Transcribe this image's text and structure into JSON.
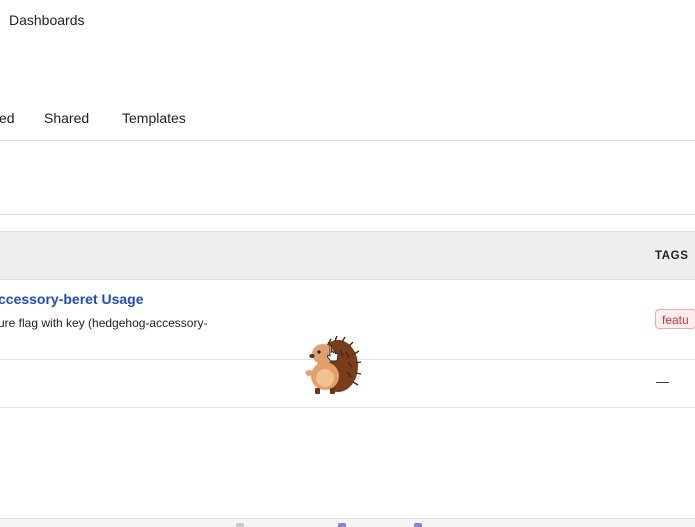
{
  "breadcrumb": {
    "title": "Dashboards"
  },
  "tabs": [
    {
      "label": "ed"
    },
    {
      "label": "Shared"
    },
    {
      "label": "Templates"
    }
  ],
  "table": {
    "columns": {
      "tags": "TAGS"
    },
    "rows": [
      {
        "title": "ccessory-beret Usage",
        "description": "ure flag with key (hedgehog-accessory-",
        "tag": "featu"
      },
      {
        "tags_placeholder": "—"
      }
    ]
  },
  "colors": {
    "link": "#1e49d4",
    "tag_text": "#c93434",
    "tag_border": "#f3a8a8",
    "header_bg": "#eeeeee"
  },
  "icons": {
    "mascot": "hedgehog-mascot-icon",
    "cursor": "hand-pointer-icon"
  }
}
